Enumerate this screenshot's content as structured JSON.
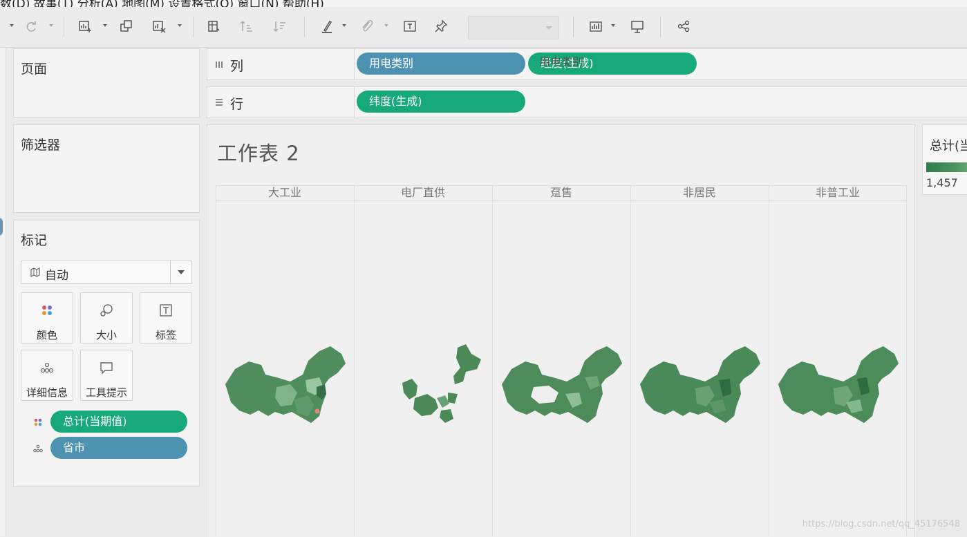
{
  "menubar": {
    "text": "数(D) 故事(T) 分析(A) 地图(M) 设置格式(O) 窗口(N) 帮助(H)"
  },
  "toolbar": {
    "icons": [
      "undo-dropdown",
      "redo-icon",
      "new-worksheet-icon",
      "duplicate-sheet-icon",
      "clear-sheet-icon",
      "swap-rows-columns-icon",
      "sort-ascending-icon",
      "sort-descending-icon",
      "highlight-icon",
      "group-icon",
      "label-icon",
      "pin-icon",
      "fit-dropdown",
      "show-me-icon",
      "presentation-icon",
      "share-icon"
    ]
  },
  "panes": {
    "pages_title": "页面",
    "filters_title": "筛选器",
    "marks_title": "标记",
    "marks_type": "自动",
    "mark_buttons": [
      {
        "label": "颜色",
        "icon": "color-icon"
      },
      {
        "label": "大小",
        "icon": "size-icon"
      },
      {
        "label": "标签",
        "icon": "label-icon"
      },
      {
        "label": "详细信息",
        "icon": "detail-icon"
      },
      {
        "label": "工具提示",
        "icon": "tooltip-icon"
      }
    ],
    "mark_pills": [
      {
        "label": "总计(当期值)",
        "kind": "color",
        "color": "#18a97a"
      },
      {
        "label": "省市",
        "kind": "detail",
        "color": "#4e92b1"
      }
    ]
  },
  "shelves": {
    "columns_label": "列",
    "rows_label": "行",
    "columns_pills": [
      {
        "label": "用电类别",
        "color": "#4e92b1"
      },
      {
        "label": "经度(生成)",
        "color": "#18a97a"
      }
    ],
    "rows_pills": [
      {
        "label": "纬度(生成)",
        "color": "#18a97a"
      }
    ]
  },
  "sheet": {
    "title": "工作表 2",
    "group_header": "用电类别",
    "columns": [
      "大工业",
      "电厂直供",
      "趸售",
      "非居民",
      "非普工业"
    ]
  },
  "legend": {
    "title": "总计(当",
    "min_value": "1,457",
    "gradient": [
      "#2f7d4a",
      "#76b183"
    ]
  },
  "watermark": "https://blog.csdn.net/qq_45176548"
}
